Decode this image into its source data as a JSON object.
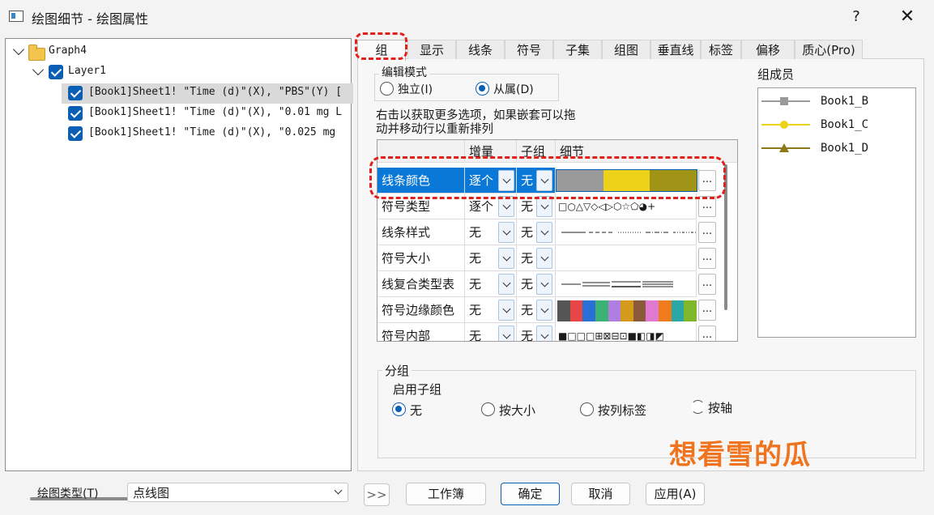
{
  "window": {
    "title": "绘图细节 - 绘图属性",
    "help": "?",
    "close": "✕"
  },
  "tree": {
    "root": "Graph4",
    "layer": "Layer1",
    "plots": [
      "[Book1]Sheet1! \"Time (d)\"(X), \"PBS\"(Y) [",
      "[Book1]Sheet1! \"Time (d)\"(X), \"0.01 mg L",
      "[Book1]Sheet1! \"Time (d)\"(X), \"0.025 mg"
    ]
  },
  "tabs": [
    "组",
    "显示",
    "线条",
    "符号",
    "子集",
    "组图",
    "垂直线",
    "标签",
    "偏移",
    "质心(Pro)"
  ],
  "edit_mode": {
    "legend": "编辑模式",
    "independent": "独立(I)",
    "dependent": "从属(D)",
    "selected": "dependent"
  },
  "hint": [
    "右击以获取更多选项，如果嵌套可以拖",
    "动并移动行以重新排列"
  ],
  "grid": {
    "headers": [
      "增量",
      "子组",
      "细节"
    ],
    "rows": [
      {
        "name": "线条颜色",
        "increment": "逐个",
        "subgroup": "无"
      },
      {
        "name": "符号类型",
        "increment": "逐个",
        "subgroup": "无",
        "detail": "□○△▽◇◁▷⬡☆⬠◕+"
      },
      {
        "name": "线条样式",
        "increment": "无",
        "subgroup": "无"
      },
      {
        "name": "符号大小",
        "increment": "无",
        "subgroup": "无"
      },
      {
        "name": "线复合类型表",
        "increment": "无",
        "subgroup": "无"
      },
      {
        "name": "符号边缘颜色",
        "increment": "无",
        "subgroup": "无"
      },
      {
        "name": "符号内部",
        "increment": "无",
        "subgroup": "无",
        "detail": "■□□□⊞⊠⊟⊡■◧◨◩"
      }
    ],
    "ellipsis": "..."
  },
  "colors": {
    "line_color_swatches": [
      "#9a9a9a",
      "#eed21a",
      "#a09416"
    ],
    "edge_color_swatches": [
      "#555555",
      "#e64646",
      "#2a6fd6",
      "#3bb273",
      "#b07de0",
      "#d49a1a",
      "#8a5a3a",
      "#e07ad0",
      "#f07b1d",
      "#2aa8a8",
      "#7fb82a"
    ],
    "accent": "#0a5fb4",
    "selection": "#0a78d7",
    "annotation": "#e0201a",
    "watermark": "#f0741e"
  },
  "members": {
    "title": "组成员",
    "items": [
      {
        "label": "Book1_B",
        "color": "#9a9a9a",
        "marker": "square"
      },
      {
        "label": "Book1_C",
        "color": "#eed21a",
        "marker": "circle"
      },
      {
        "label": "Book1_D",
        "color": "#8c7a18",
        "marker": "triangle"
      }
    ]
  },
  "grouping": {
    "legend": "分组",
    "enable_subgroup": "启用子组",
    "options": [
      "无",
      "按大小",
      "按列标签",
      "按轴"
    ],
    "selected": "无"
  },
  "bottom": {
    "plot_type_label": "绘图类型(T)",
    "plot_type_value": "点线图",
    "expand": ">>",
    "workbook": "工作簿",
    "ok": "确定",
    "cancel": "取消",
    "apply": "应用(A)"
  },
  "watermark": "想看雪的瓜"
}
